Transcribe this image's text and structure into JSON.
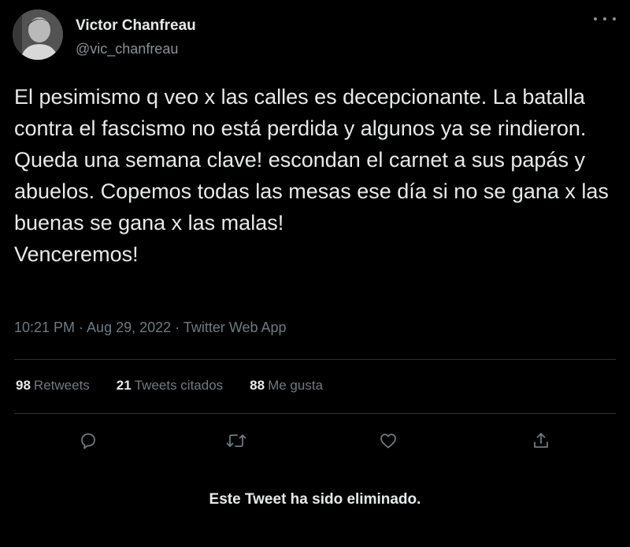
{
  "author": {
    "name": "Victor Chanfreau",
    "handle": "@vic_chanfreau"
  },
  "tweet": {
    "lines": [
      "El pesimismo q veo x las calles es decepcionante. La batalla contra el fascismo no está perdida y algunos ya se rindieron.",
      "Queda una semana clave! escondan el carnet a sus papás y abuelos. Copemos todas las mesas ese día si no se gana x las buenas se gana x las malas!",
      "Venceremos!"
    ],
    "meta": "10:21 PM · Aug 29, 2022 · Twitter Web App"
  },
  "stats": {
    "retweets_count": "98",
    "retweets_label": "Retweets",
    "quotes_count": "21",
    "quotes_label": "Tweets citados",
    "likes_count": "88",
    "likes_label": "Me gusta"
  },
  "actions": {
    "reply_icon": "reply-icon",
    "retweet_icon": "retweet-icon",
    "like_icon": "heart-icon",
    "share_icon": "share-icon"
  },
  "notice": "Este Tweet ha sido eliminado.",
  "colors": {
    "background": "#000000",
    "primary_text": "#e7e9ea",
    "secondary_text": "#717a80",
    "divider": "#2f3336"
  }
}
